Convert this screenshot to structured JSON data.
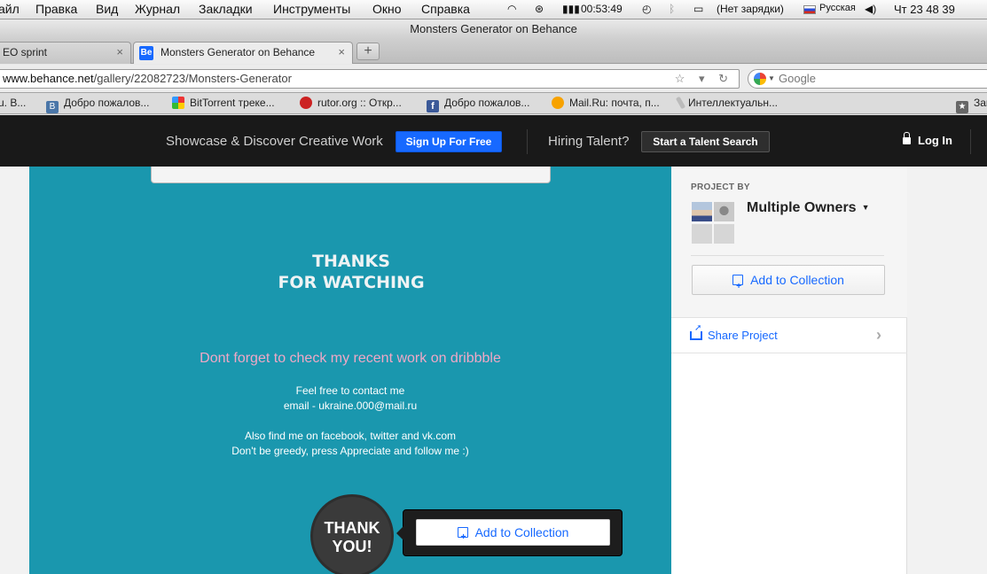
{
  "menubar": {
    "items": [
      "айл",
      "Правка",
      "Вид",
      "Журнал",
      "Закладки",
      "Инструменты",
      "Окно",
      "Справка"
    ],
    "clock": "00:53:49",
    "battery": "(Нет зарядки)",
    "input_lang": "Русская",
    "datetime": "Чт 23 48 39"
  },
  "window": {
    "title": "Monsters Generator on Behance"
  },
  "tabs": [
    {
      "label": "EO sprint"
    },
    {
      "label": "Monsters Generator on Behance"
    }
  ],
  "tab_close": "×",
  "new_tab": "+",
  "nav": {
    "url_domain": "www.behance.net",
    "url_path": "/gallery/22082723/Monsters-Generator",
    "url_icons": "☆ ▾ ↻",
    "search_placeholder": "Google"
  },
  "bookmarks": [
    {
      "label": "ru. В..."
    },
    {
      "label": "Добро пожалов..."
    },
    {
      "label": "BitTorrent треке..."
    },
    {
      "label": "rutor.org :: Откр..."
    },
    {
      "label": "Добро пожалов..."
    },
    {
      "label": "Mail.Ru: почта, п..."
    },
    {
      "label": "Интеллектуальн..."
    },
    {
      "label": "Зап"
    }
  ],
  "behance_header": {
    "tagline": "Showcase & Discover Creative Work",
    "signup": "Sign Up For Free",
    "hiring": "Hiring Talent?",
    "talent_search": "Start a Talent Search",
    "login": "Log In"
  },
  "project": {
    "thanks_line1": "THANKS",
    "thanks_line2": "FOR WATCHING",
    "dribbble": "Dont forget to check my recent work on dribbble",
    "contact_line1": "Feel free to contact me",
    "contact_line2": "email - ukraine.000@mail.ru",
    "social_line1": "Also find me on facebook, twitter and vk.com",
    "social_line2": "Don't be greedy, press Appreciate and follow me :)",
    "badge_line1": "THANK",
    "badge_line2": "YOU!",
    "add_to_collection": "Add to Collection"
  },
  "sidebar": {
    "project_by": "PROJECT BY",
    "owners": "Multiple Owners",
    "owners_caret": "▼",
    "add_to_collection": "Add to Collection",
    "share": "Share Project",
    "share_arrow": "›"
  },
  "colors": {
    "behance_blue": "#1769ff",
    "project_bg": "#1a97ae",
    "header_bg": "#191919",
    "dribbble_pink": "#f0a8c6"
  }
}
